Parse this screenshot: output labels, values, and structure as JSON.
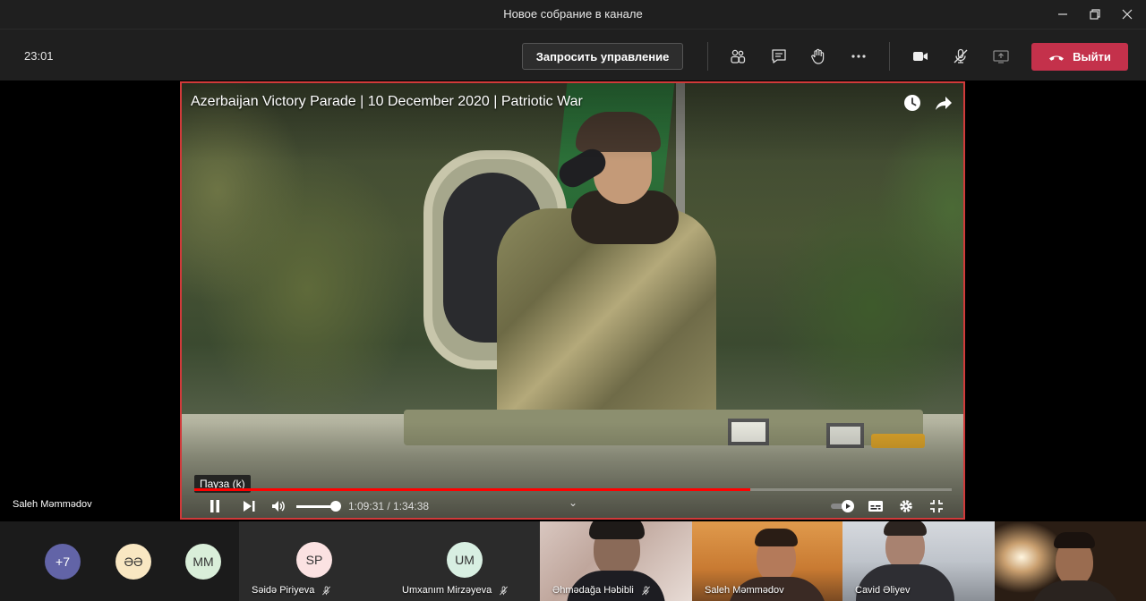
{
  "window": {
    "title": "Новое собрание в канале"
  },
  "toolbar": {
    "timer": "23:01",
    "request_control_label": "Запросить управление",
    "leave_label": "Выйти"
  },
  "video": {
    "title": "Azerbaijan Victory Parade | 10 December 2020 | Patriotic War",
    "tooltip": "Пауза (k)",
    "time_display": "1:09:31 / 1:34:38",
    "progress_fraction": 0.7346
  },
  "presenter": {
    "name": "Saleh Məmmədov"
  },
  "participants": {
    "overflow": "+7",
    "avatars": [
      {
        "initials": "ƏƏ",
        "color": "#f9e7c2"
      },
      {
        "initials": "MM",
        "color": "#d9eed9"
      }
    ],
    "tiles": [
      {
        "initials": "SP",
        "name": "Səidə Piriyeva",
        "avatar_color": "#fbe2e2"
      },
      {
        "initials": "UM",
        "name": "Umxanım Mirzəyeva",
        "avatar_color": "#d8efe2"
      },
      {
        "name": "Əhmədağa Həbibli"
      },
      {
        "name": "Saleh Məmmədov"
      },
      {
        "name": "Cavid Əliyev"
      }
    ]
  },
  "colors": {
    "accent_red": "#c4314b",
    "overflow_purple": "#6264a7"
  }
}
